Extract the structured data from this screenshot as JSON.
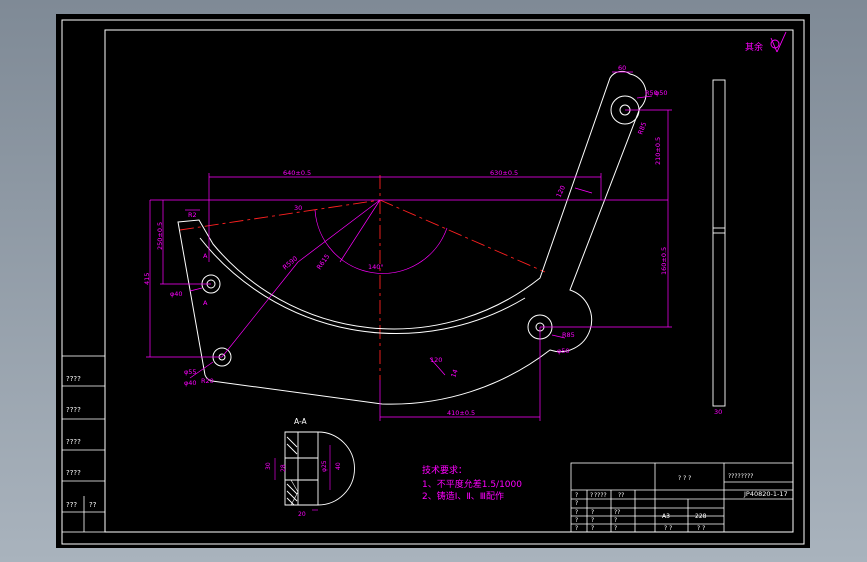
{
  "colors": {
    "background": "#000000",
    "frame": "#ffffff",
    "dimension": "#ff00ff",
    "centerline": "#ff2020",
    "part_outline": "#ffffff"
  },
  "labels": {
    "roughness_note": "其余",
    "section_title": "A-A",
    "tech_req_title": "技术要求：",
    "tech_req_1": "1、不平度允差1.5/1000",
    "tech_req_2": "2、铸造Ⅰ、Ⅱ、Ⅲ配作",
    "drawing_number": "JP40820-1-17",
    "title_name": "????????",
    "title_mid": "? ? ?",
    "material": "A3",
    "weight": "228",
    "scale_a": "? ?",
    "scale_b": "? ?"
  },
  "dimensions": {
    "d_640": "640±0.5",
    "d_630": "630±0.5",
    "d_410": "410±0.5",
    "d_210": "210±0.5",
    "d_160": "160±0.5",
    "d_250": "250±0.5",
    "d_415": "415",
    "d_60": "60",
    "d_r50": "R50",
    "d_r85": "R85",
    "d_r85b": "R85",
    "d_phi50": "φ50",
    "d_phi50b": "φ50",
    "d_phi55": "φ55",
    "d_phi40": "φ40",
    "d_phi40b": "φ40",
    "d_r590": "R590",
    "d_r615": "R615",
    "d_120": "120",
    "d_120b": "120",
    "d_r20": "R20",
    "d_14": "14",
    "d_140": "140°",
    "d_30": "30",
    "d_x3_label": "A",
    "d_x3_label_b": "A",
    "d_r2": "R2",
    "sec_30": "30",
    "sec_28": "28",
    "sec_20": "20",
    "sec_phi": "φ25",
    "sec_40": "40"
  },
  "left_block": {
    "rows": [
      "????",
      "????",
      "????",
      "????",
      "???",
      "??"
    ]
  },
  "title_block": {
    "small_cells": [
      "?",
      "?",
      "????",
      "??",
      "?",
      "?",
      "?",
      "?",
      "??",
      "?",
      "?",
      "?",
      "?",
      "?"
    ]
  }
}
